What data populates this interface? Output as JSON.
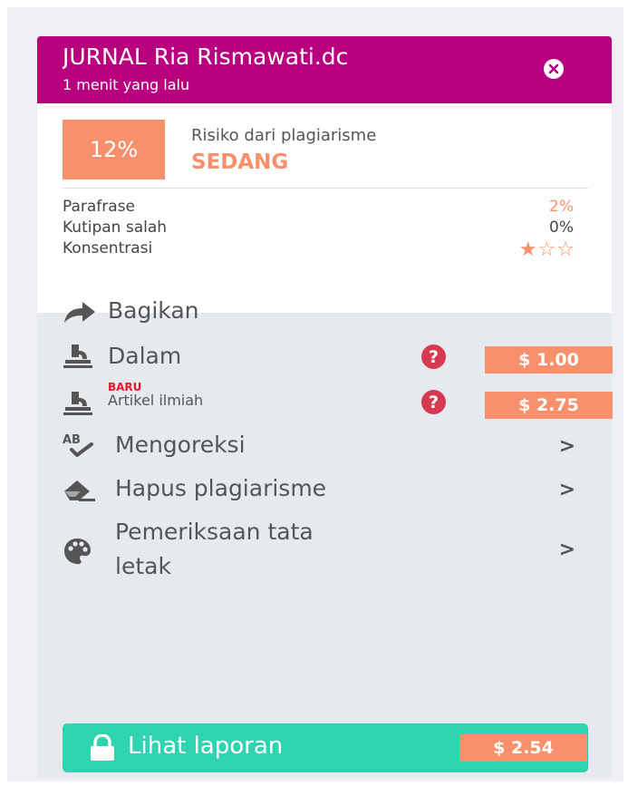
{
  "header": {
    "title": "JURNAL Ria Rismawati.dc",
    "subtitle": "1 menit yang lalu",
    "color": "#b8007f"
  },
  "risk": {
    "percent": "12%",
    "label": "Risiko dari plagiarisme",
    "level": "SEDANG",
    "accent": "#f9906c"
  },
  "metrics": [
    {
      "label": "Parafrase",
      "value": "2%"
    },
    {
      "label": "Kutipan salah",
      "value": "0%"
    },
    {
      "label": "Konsentrasi",
      "value": "★☆☆",
      "rating": 1,
      "max": 3
    }
  ],
  "menu": {
    "share": {
      "label": "Bagikan",
      "icon": "share-icon"
    },
    "dalam": {
      "label": "Dalam",
      "price": "$ 1.00",
      "icon": "upload-icon"
    },
    "artikel": {
      "badge": "BARU",
      "label": "Artikel ilmiah",
      "price": "$ 2.75",
      "icon": "upload-icon"
    },
    "correct": {
      "label": "Mengoreksi",
      "icon": "spellcheck-icon"
    },
    "remove": {
      "label": "Hapus plagiarisme",
      "icon": "eraser-icon"
    },
    "layout": {
      "label_line1": "Pemeriksaan tata",
      "label_line2": "letak",
      "icon": "palette-icon"
    }
  },
  "report": {
    "label": "Lihat laporan",
    "price": "$ 2.54",
    "color": "#2fd3b0"
  }
}
